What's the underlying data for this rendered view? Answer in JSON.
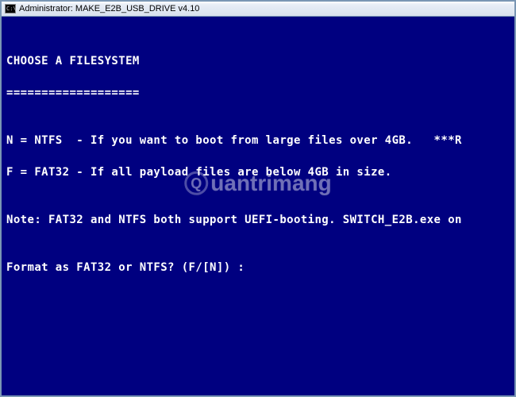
{
  "titlebar": {
    "icon_label": "C:\\",
    "title": "Administrator:  MAKE_E2B_USB_DRIVE v4.10"
  },
  "terminal": {
    "blank0": "",
    "header_line": "CHOOSE A FILESYSTEM",
    "header_underline": "===================",
    "blank1": "",
    "opt_n": "N = NTFS  - If you want to boot from large files over 4GB.   ***R",
    "opt_f": "F = FAT32 - If all payload files are below 4GB in size.",
    "blank2": "",
    "note": "Note: FAT32 and NTFS both support UEFI-booting. SWITCH_E2B.exe on",
    "blank3": "",
    "prompt": "Format as FAT32 or NTFS? (F/[N]) :"
  },
  "watermark": {
    "text": "uantrimang",
    "icon_letter": "Q"
  }
}
